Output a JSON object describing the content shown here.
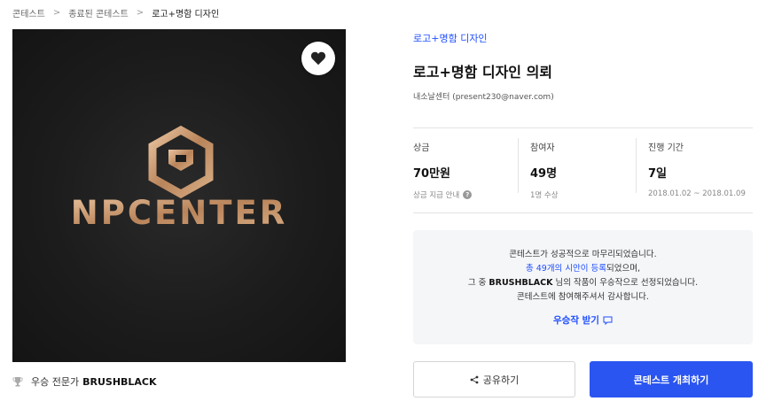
{
  "breadcrumb": {
    "items": [
      "콘테스트",
      "종료된 콘테스트",
      "로고+명함 디자인"
    ]
  },
  "hero": {
    "logo_text": "NPCENTER",
    "favorite_icon": "heart-icon"
  },
  "winner": {
    "label": "우승 전문가",
    "name": "BRUSHBLACK",
    "icon": "trophy-icon"
  },
  "contest": {
    "category": "로고+명함 디자인",
    "title": "로고+명함 디자인 의뢰",
    "host": "내소날센터 (present230@naver.com)"
  },
  "stats": {
    "prize": {
      "label": "상금",
      "value": "70만원",
      "sub": "상금 지급 안내"
    },
    "participants": {
      "label": "참여자",
      "value": "49명",
      "sub": "1명 수상"
    },
    "period": {
      "label": "진행 기간",
      "value": "7일",
      "sub": "2018.01.02 ~ 2018.01.09"
    }
  },
  "notice": {
    "line1": "콘테스트가 성공적으로 마무리되었습니다.",
    "line2_link": "총 49개의 시안이 등록",
    "line2_rest": "되었으며,",
    "line3_pre": "그 중 ",
    "line3_name": "BRUSHBLACK",
    "line3_post": " 님의 작품이 우승작으로 선정되었습니다.",
    "line4": "콘테스트에 참여해주셔서 감사합니다.",
    "cta": "우승작 받기"
  },
  "actions": {
    "share": "공유하기",
    "host": "콘테스트 개최하기"
  },
  "colors": {
    "accent": "#2b55f0",
    "link": "#1f4fff",
    "logo_gold": "#c99a6e"
  }
}
